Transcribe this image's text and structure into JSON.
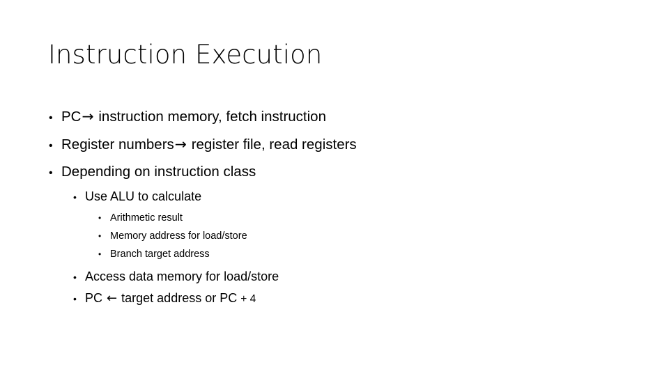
{
  "slide": {
    "title": "Instruction Execution",
    "background_color": "#ffffff",
    "text_color": "#000000",
    "bullets": [
      {
        "level": 1,
        "marker": "•",
        "text": "PC → instruction memory, fetch instruction",
        "pre_arrow": "PC",
        "arrow": "→",
        "post_arrow": "instruction memory, fetch instruction"
      },
      {
        "level": 1,
        "marker": "•",
        "text": "Register numbers → register file, read registers",
        "pre_arrow": "Register numbers",
        "arrow": "→",
        "post_arrow": "register file, read registers"
      },
      {
        "level": 1,
        "marker": "•",
        "text": "Depending on instruction class"
      },
      {
        "level": 2,
        "marker": "•",
        "text": "Use ALU to calculate"
      },
      {
        "level": 3,
        "marker": "•",
        "text": "Arithmetic result"
      },
      {
        "level": 3,
        "marker": "•",
        "text": "Memory address for load/store"
      },
      {
        "level": 3,
        "marker": "•",
        "text": "Branch target address"
      },
      {
        "level": 2,
        "marker": "•",
        "text": "Access data memory for load/store"
      },
      {
        "level": 2,
        "marker": "•",
        "text": "PC ← target address or PC + 4",
        "pre_arrow": "PC",
        "arrow": "←",
        "post_arrow": "target address or PC",
        "tail": "+ 4"
      }
    ]
  }
}
